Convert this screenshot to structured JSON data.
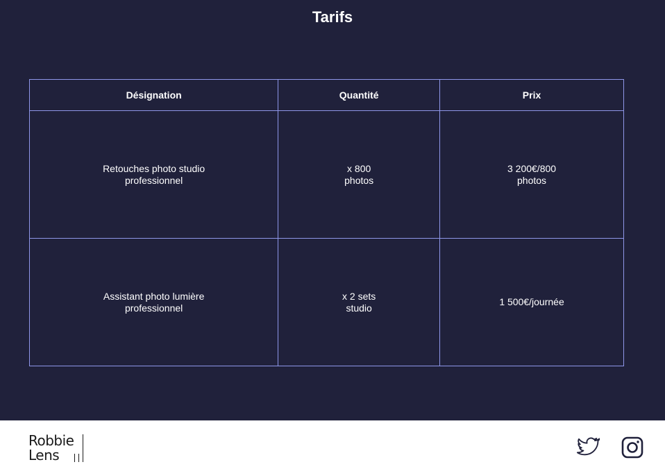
{
  "page": {
    "title": "Tarifs"
  },
  "table": {
    "headers": [
      "Désignation",
      "Quantité",
      "Prix"
    ],
    "rows": [
      {
        "designation": "Retouches photo studio professionnel",
        "quantite": "x 800 photos",
        "prix": "3 200€/800 photos"
      },
      {
        "designation": "Assistant photo lumière professionnel",
        "quantite": "x 2 sets studio",
        "prix": "1 500€/journée"
      }
    ]
  },
  "footer": {
    "logo": {
      "line1": "Robbie",
      "line2": "Lens"
    },
    "social": [
      {
        "icon": "twitter-icon"
      },
      {
        "icon": "instagram-icon"
      }
    ]
  },
  "colors": {
    "background": "#20213b",
    "table_border": "#8f97ea",
    "text": "#ffffff",
    "footer_background": "#ffffff"
  }
}
